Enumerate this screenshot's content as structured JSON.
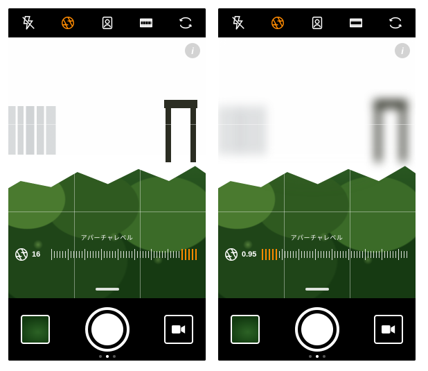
{
  "phones": [
    {
      "aperture_label": "アパーチャレベル",
      "aperture_value": "16",
      "blur": false,
      "ruler_hot_side": "right"
    },
    {
      "aperture_label": "アパーチャレベル",
      "aperture_value": "0.95",
      "blur": true,
      "ruler_hot_side": "left"
    }
  ],
  "icons": {
    "flash_off": "flash-off-icon",
    "aperture": "aperture-icon",
    "portrait": "portrait-icon",
    "filmstrip": "filmstrip-icon",
    "flip": "camera-flip-icon",
    "info": "i",
    "video": "video-icon"
  },
  "colors": {
    "accent": "#ff8a00"
  }
}
